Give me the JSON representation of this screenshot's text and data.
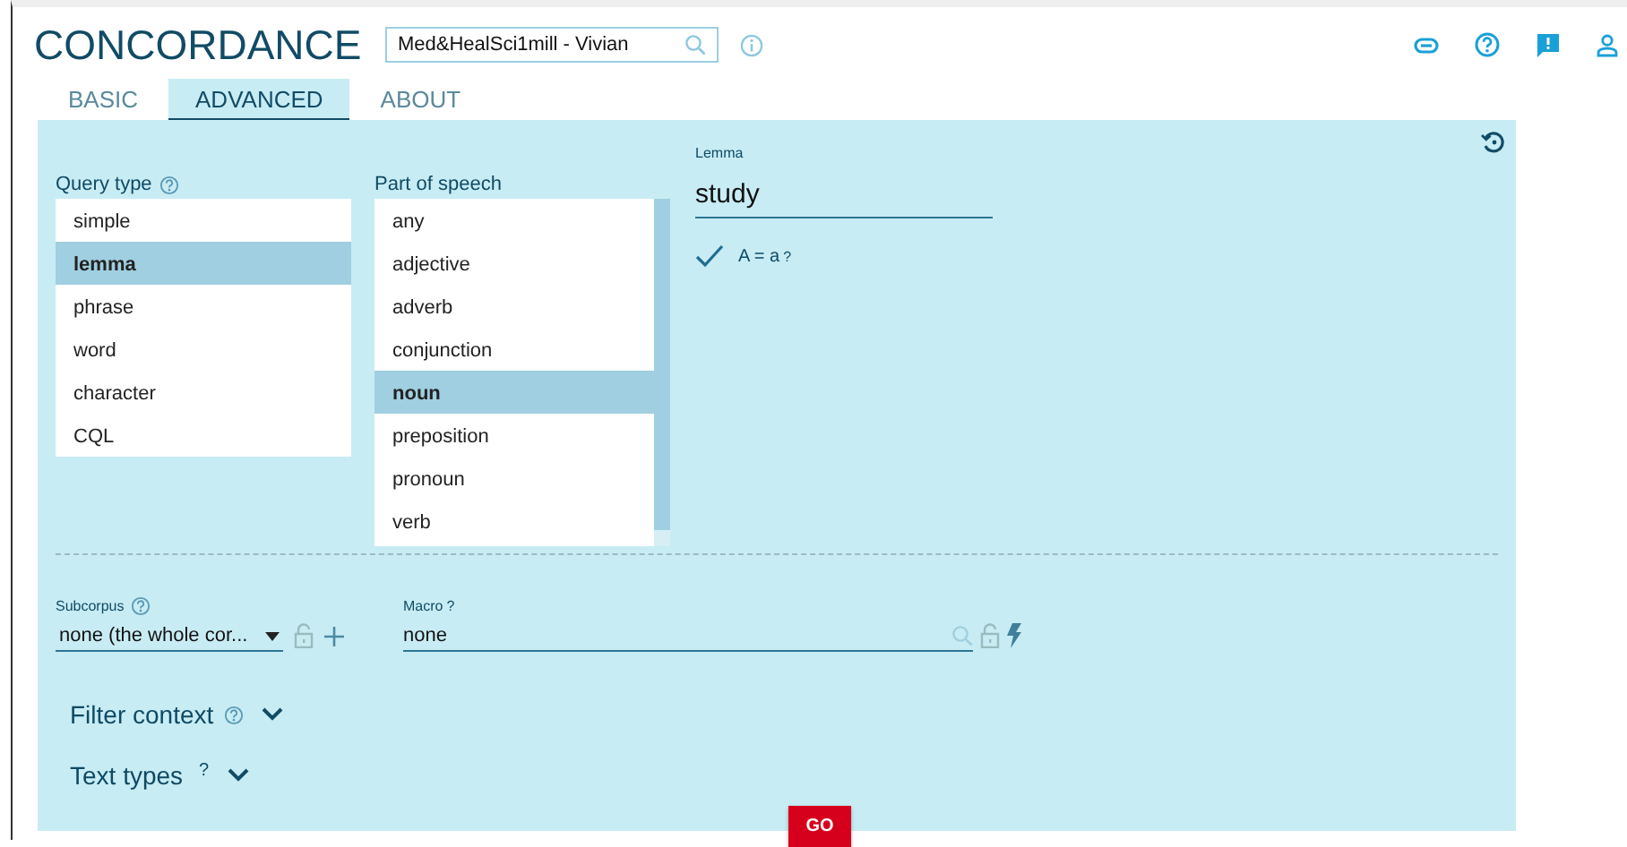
{
  "header": {
    "title": "CONCORDANCE",
    "corpus": "Med&HealSci1mill - Vivian"
  },
  "tabs": [
    {
      "label": "BASIC",
      "selected": false
    },
    {
      "label": "ADVANCED",
      "selected": true
    },
    {
      "label": "ABOUT",
      "selected": false
    }
  ],
  "query_type": {
    "label": "Query type",
    "options": [
      {
        "label": "simple",
        "selected": false
      },
      {
        "label": "lemma",
        "selected": true
      },
      {
        "label": "phrase",
        "selected": false
      },
      {
        "label": "word",
        "selected": false
      },
      {
        "label": "character",
        "selected": false
      },
      {
        "label": "CQL",
        "selected": false
      }
    ]
  },
  "part_of_speech": {
    "label": "Part of speech",
    "options": [
      {
        "label": "any",
        "selected": false
      },
      {
        "label": "adjective",
        "selected": false
      },
      {
        "label": "adverb",
        "selected": false
      },
      {
        "label": "conjunction",
        "selected": false
      },
      {
        "label": "noun",
        "selected": true
      },
      {
        "label": "preposition",
        "selected": false
      },
      {
        "label": "pronoun",
        "selected": false
      },
      {
        "label": "verb",
        "selected": false
      }
    ]
  },
  "lemma": {
    "label": "Lemma",
    "value": "study",
    "match_case": {
      "label": "A = a",
      "help": "?",
      "checked": true
    }
  },
  "subcorpus": {
    "label": "Subcorpus",
    "value": "none (the whole cor..."
  },
  "macro": {
    "label": "Macro",
    "help": "?",
    "value": "none"
  },
  "sections": [
    {
      "kind": "help-icon",
      "label": "Filter context",
      "expanded": false
    },
    {
      "kind": "help-mark",
      "label": "Text types",
      "help": "?",
      "expanded": false
    }
  ],
  "go_button": "GO"
}
